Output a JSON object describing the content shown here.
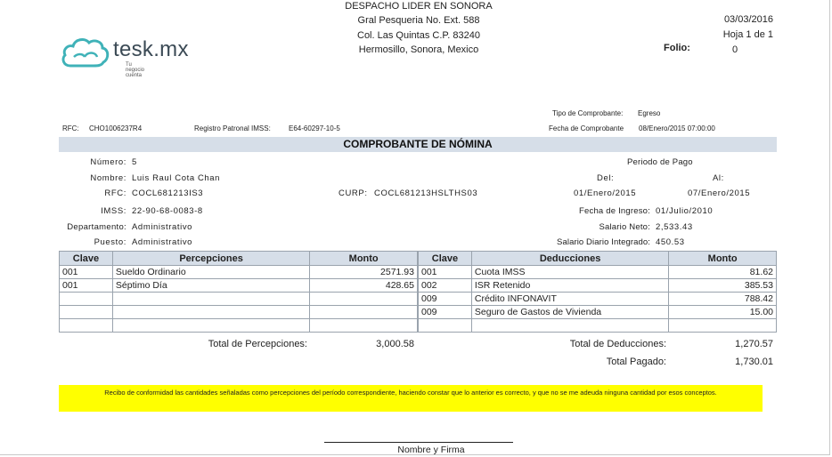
{
  "company": {
    "name": "DESPACHO LIDER EN SONORA",
    "line1": "Gral Pesqueria No. Ext. 588",
    "line2": "Col. Las Quintas C.P. 83240",
    "line3": "Hermosillo, Sonora, Mexico"
  },
  "logo": {
    "text": "tesk.mx",
    "tagline": "Tu negocio cuenta",
    "color": "#3fb2b8"
  },
  "header": {
    "date": "03/03/2016",
    "page": "Hoja 1 de 1",
    "folio_label": "Folio:",
    "folio_value": "0"
  },
  "meta": {
    "tipo_label": "Tipo de Comprobante:",
    "tipo_value": "Egreso",
    "fecha_label": "Fecha de Comprobante",
    "fecha_value": "08/Enero/2015 07:00:00",
    "rfc_label": "RFC:",
    "rfc_value": "CHO1006237R4",
    "registro_label": "Registro Patronal IMSS:",
    "registro_value": "E64-60297-10-5"
  },
  "title": "COMPROBANTE DE NÓMINA",
  "employee": {
    "numero_label": "Número:",
    "numero_value": "5",
    "nombre_label": "Nombre:",
    "nombre_value": "Luis Raul Cota  Chan",
    "rfc_label": "RFC:",
    "rfc_value": "COCL681213IS3",
    "curp_label": "CURP:",
    "curp_value": "COCL681213HSLTHS03",
    "imss_label": "IMSS:",
    "imss_value": "22-90-68-0083-8",
    "depto_label": "Departamento:",
    "depto_value": "Administrativo",
    "puesto_label": "Puesto:",
    "puesto_value": "Administrativo",
    "periodo_label": "Periodo de Pago",
    "del_label": "Del:",
    "al_label": "Al:",
    "del_value": "01/Enero/2015",
    "al_value": "07/Enero/2015",
    "ingreso_label": "Fecha de Ingreso:",
    "ingreso_value": "01/Julio/2010",
    "neto_label": "Salario Neto:",
    "neto_value": "2,533.43",
    "diario_label": "Salario Diario Integrado:",
    "diario_value": "450.53"
  },
  "percepciones": {
    "headers": [
      "Clave",
      "Percepciones",
      "Monto"
    ],
    "rows": [
      [
        "001",
        "Sueldo Ordinario",
        "2571.93"
      ],
      [
        "001",
        "Séptimo Día",
        "428.65"
      ],
      [
        "",
        "",
        ""
      ],
      [
        "",
        "",
        ""
      ],
      [
        "",
        "",
        ""
      ]
    ],
    "total_label": "Total de Percepciones:",
    "total_value": "3,000.58"
  },
  "deducciones": {
    "headers": [
      "Clave",
      "Deducciones",
      "Monto"
    ],
    "rows": [
      [
        "001",
        "Cuota IMSS",
        "81.62"
      ],
      [
        "002",
        "ISR Retenido",
        "385.53"
      ],
      [
        "009",
        "Crédito INFONAVIT",
        "788.42"
      ],
      [
        "009",
        "Seguro de Gastos de Vivienda",
        "15.00"
      ],
      [
        "",
        "",
        ""
      ]
    ],
    "total_label": "Total de Deducciones:",
    "total_value": "1,270.57",
    "pagado_label": "Total Pagado:",
    "pagado_value": "1,730.01"
  },
  "notice": "Recibo de conformidad las cantidades señaladas como percepciones del período correspondiente, haciendo constar que lo anterior es correcto, y que no se me adeuda ninguna cantidad por esos conceptos.",
  "signature_label": "Nombre y Firma"
}
